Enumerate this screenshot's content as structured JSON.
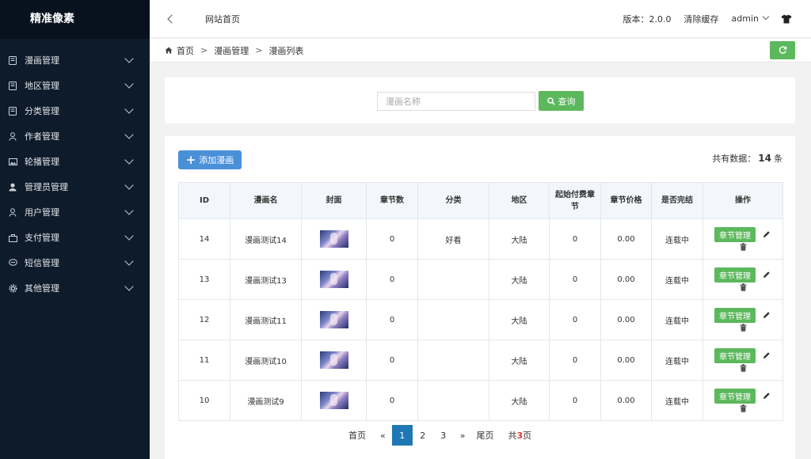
{
  "sidebar": {
    "logo": "精准像素",
    "items": [
      {
        "label": "漫画管理",
        "icon": "book-icon"
      },
      {
        "label": "地区管理",
        "icon": "book-icon"
      },
      {
        "label": "分类管理",
        "icon": "book-icon"
      },
      {
        "label": "作者管理",
        "icon": "user-outline-icon"
      },
      {
        "label": "轮播管理",
        "icon": "image-icon"
      },
      {
        "label": "管理员管理",
        "icon": "user-icon"
      },
      {
        "label": "用户管理",
        "icon": "user-outline-icon"
      },
      {
        "label": "支付管理",
        "icon": "bag-icon"
      },
      {
        "label": "短信管理",
        "icon": "chat-icon"
      },
      {
        "label": "其他管理",
        "icon": "gear-icon"
      }
    ]
  },
  "topbar": {
    "site_home": "网站首页",
    "version": "版本：2.0.0",
    "clear_cache": "清除缓存",
    "user": "admin"
  },
  "breadcrumb": {
    "home": "首页",
    "sep": ">",
    "level1": "漫画管理",
    "level2": "漫画列表"
  },
  "search": {
    "placeholder": "漫画名称",
    "value": "",
    "button": "查询"
  },
  "toolbar": {
    "add_label": "添加漫画",
    "total_prefix": "共有数据：",
    "total_count": "14",
    "total_suffix": "条"
  },
  "table": {
    "headers": [
      "ID",
      "漫画名",
      "封面",
      "章节数",
      "分类",
      "地区",
      "起始付费章节",
      "章节价格",
      "是否完结",
      "操作"
    ],
    "rows": [
      {
        "id": "14",
        "name": "漫画测试14",
        "chapters": "0",
        "category": "好看",
        "region": "大陆",
        "paid_start": "0",
        "price": "0.00",
        "status": "连载中"
      },
      {
        "id": "13",
        "name": "漫画测试13",
        "chapters": "0",
        "category": "",
        "region": "大陆",
        "paid_start": "0",
        "price": "0.00",
        "status": "连载中"
      },
      {
        "id": "12",
        "name": "漫画测试11",
        "chapters": "0",
        "category": "",
        "region": "大陆",
        "paid_start": "0",
        "price": "0.00",
        "status": "连载中"
      },
      {
        "id": "11",
        "name": "漫画测试10",
        "chapters": "0",
        "category": "",
        "region": "大陆",
        "paid_start": "0",
        "price": "0.00",
        "status": "连载中"
      },
      {
        "id": "10",
        "name": "漫画测试9",
        "chapters": "0",
        "category": "",
        "region": "大陆",
        "paid_start": "0",
        "price": "0.00",
        "status": "连载中"
      }
    ],
    "chapter_btn": "章节管理"
  },
  "pagination": {
    "first": "首页",
    "prev": "«",
    "pages": [
      "1",
      "2",
      "3"
    ],
    "next": "»",
    "last": "尾页",
    "total_prefix": "共",
    "total_pages": "3",
    "total_suffix": "页"
  }
}
